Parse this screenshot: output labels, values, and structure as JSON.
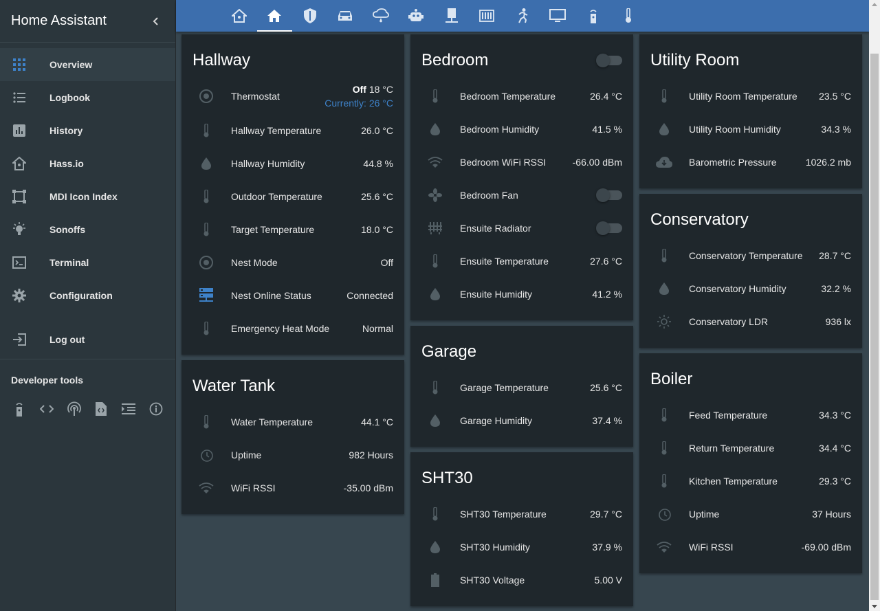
{
  "app": {
    "title": "Home Assistant"
  },
  "sidebar": {
    "items": [
      {
        "label": "Overview",
        "icon": "view-dashboard-icon"
      },
      {
        "label": "Logbook",
        "icon": "format-list-bulleted-icon"
      },
      {
        "label": "History",
        "icon": "chart-box-icon"
      },
      {
        "label": "Hass.io",
        "icon": "home-assistant-icon"
      },
      {
        "label": "MDI Icon Index",
        "icon": "vector-square-icon"
      },
      {
        "label": "Sonoffs",
        "icon": "lightbulb-on-icon"
      },
      {
        "label": "Terminal",
        "icon": "console-icon"
      },
      {
        "label": "Configuration",
        "icon": "gear-icon"
      }
    ],
    "logout": "Log out",
    "dev_tools_title": "Developer tools",
    "dev_tools": [
      "remote-icon",
      "code-tags-icon",
      "podcast-icon",
      "file-code-icon",
      "format-indent-icon",
      "info-icon"
    ]
  },
  "tabs": [
    "home-assistant-icon",
    "home-icon",
    "security-icon",
    "car-icon",
    "weather-rainy-icon",
    "robot-icon",
    "desk-lamp-icon",
    "radiator-icon",
    "run-icon",
    "monitor-icon",
    "remote-icon",
    "thermometer-icon"
  ],
  "cards": {
    "hallway": {
      "title": "Hallway",
      "thermostat": {
        "name": "Thermostat",
        "state": "Off",
        "target": "18 °C",
        "current": "Currently: 26 °C"
      },
      "rows": [
        {
          "name": "Hallway Temperature",
          "value": "26.0 °C"
        },
        {
          "name": "Hallway Humidity",
          "value": "44.8 %"
        },
        {
          "name": "Outdoor Temperature",
          "value": "25.6 °C"
        },
        {
          "name": "Target Temperature",
          "value": "18.0 °C"
        },
        {
          "name": "Nest Mode",
          "value": "Off"
        },
        {
          "name": "Nest Online Status",
          "value": "Connected"
        },
        {
          "name": "Emergency Heat Mode",
          "value": "Normal"
        }
      ]
    },
    "water_tank": {
      "title": "Water Tank",
      "rows": [
        {
          "name": "Water Temperature",
          "value": "44.1 °C"
        },
        {
          "name": "Uptime",
          "value": "982 Hours"
        },
        {
          "name": "WiFi RSSI",
          "value": "-35.00 dBm"
        }
      ]
    },
    "bedroom": {
      "title": "Bedroom",
      "rows": [
        {
          "name": "Bedroom Temperature",
          "value": "26.4 °C"
        },
        {
          "name": "Bedroom Humidity",
          "value": "41.5 %"
        },
        {
          "name": "Bedroom WiFi RSSI",
          "value": "-66.00 dBm"
        },
        {
          "name": "Bedroom Fan",
          "value": ""
        },
        {
          "name": "Ensuite Radiator",
          "value": ""
        },
        {
          "name": "Ensuite Temperature",
          "value": "27.6 °C"
        },
        {
          "name": "Ensuite Humidity",
          "value": "41.2 %"
        }
      ]
    },
    "garage": {
      "title": "Garage",
      "rows": [
        {
          "name": "Garage Temperature",
          "value": "25.6 °C"
        },
        {
          "name": "Garage Humidity",
          "value": "37.4 %"
        }
      ]
    },
    "sht30": {
      "title": "SHT30",
      "rows": [
        {
          "name": "SHT30 Temperature",
          "value": "29.7 °C"
        },
        {
          "name": "SHT30 Humidity",
          "value": "37.9 %"
        },
        {
          "name": "SHT30 Voltage",
          "value": "5.00 V"
        }
      ]
    },
    "utility": {
      "title": "Utility Room",
      "rows": [
        {
          "name": "Utility Room Temperature",
          "value": "23.5 °C"
        },
        {
          "name": "Utility Room Humidity",
          "value": "34.3 %"
        },
        {
          "name": "Barometric Pressure",
          "value": "1026.2 mb"
        }
      ]
    },
    "conservatory": {
      "title": "Conservatory",
      "rows": [
        {
          "name": "Conservatory Temperature",
          "value": "28.7 °C"
        },
        {
          "name": "Conservatory Humidity",
          "value": "32.2 %"
        },
        {
          "name": "Conservatory LDR",
          "value": "936 lx"
        }
      ]
    },
    "boiler": {
      "title": "Boiler",
      "rows": [
        {
          "name": "Feed Temperature",
          "value": "34.3 °C"
        },
        {
          "name": "Return Temperature",
          "value": "34.4 °C"
        },
        {
          "name": "Kitchen Temperature",
          "value": "29.3 °C"
        },
        {
          "name": "Uptime",
          "value": "37 Hours"
        },
        {
          "name": "WiFi RSSI",
          "value": "-69.00 dBm"
        }
      ]
    }
  },
  "colors": {
    "topbar": "#3c6ead",
    "sidebar": "#2b363c",
    "card": "#1f272c",
    "background": "#37464f",
    "accent": "#3e82c9"
  }
}
